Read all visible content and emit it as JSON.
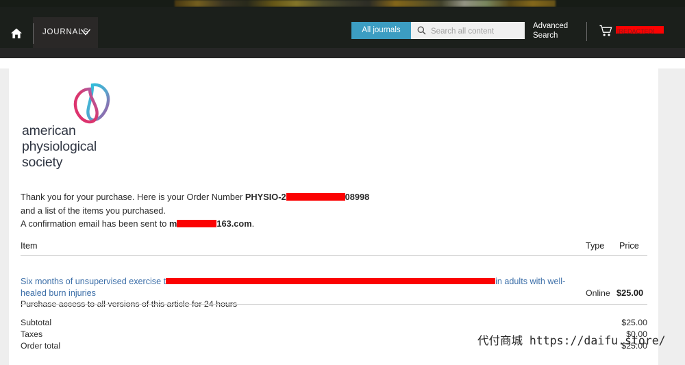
{
  "header": {
    "home_icon": "home-icon",
    "journals_label": "JOURNALS",
    "chevron_icon": "chevron-down-icon",
    "scope_button_label": "All journals",
    "search_placeholder": "Search all content",
    "search_value": "",
    "search_icon": "search-icon",
    "advanced_search_label": "Advanced Search",
    "cart_icon": "cart-icon",
    "cart_label_redacted": "[REDACTED]",
    "accent_color": "#3c9dc2",
    "bar_color": "#1b1f1b"
  },
  "logo": {
    "line1": "american",
    "line2": "physiological",
    "line3": "society",
    "mark_color_cyan": "#29c3dd",
    "mark_color_magenta": "#e0306e"
  },
  "confirmation": {
    "line1_prefix": "Thank you for your purchase. Here is your Order Number ",
    "order_prefix": "PHYSIO-2",
    "order_redacted": "[REDACTED]",
    "order_suffix": "08998",
    "line2": "and a list of the items you purchased.",
    "line3_prefix": "A confirmation email has been sent to ",
    "email_prefix": "m",
    "email_redacted": "[REDACTED]",
    "email_suffix": "163.com",
    "line3_period": "."
  },
  "table": {
    "headers": {
      "item": "Item",
      "type": "Type",
      "price": "Price"
    },
    "rows": [
      {
        "title_prefix": "Six months of unsupervised exercise t",
        "title_redacted": "[REDACTED]",
        "title_suffix": "in adults with well-healed burn injuries",
        "subtitle": "Purchase access to all versions of this article for 24 hours",
        "type": "Online",
        "price": "$25.00"
      }
    ]
  },
  "totals": [
    {
      "label": "Subtotal",
      "value": "$25.00"
    },
    {
      "label": "Taxes",
      "value": "$0.00"
    },
    {
      "label": "Order total",
      "value": "$25.00"
    }
  ],
  "watermark": {
    "text": "代付商城 https://daifu.store/"
  }
}
